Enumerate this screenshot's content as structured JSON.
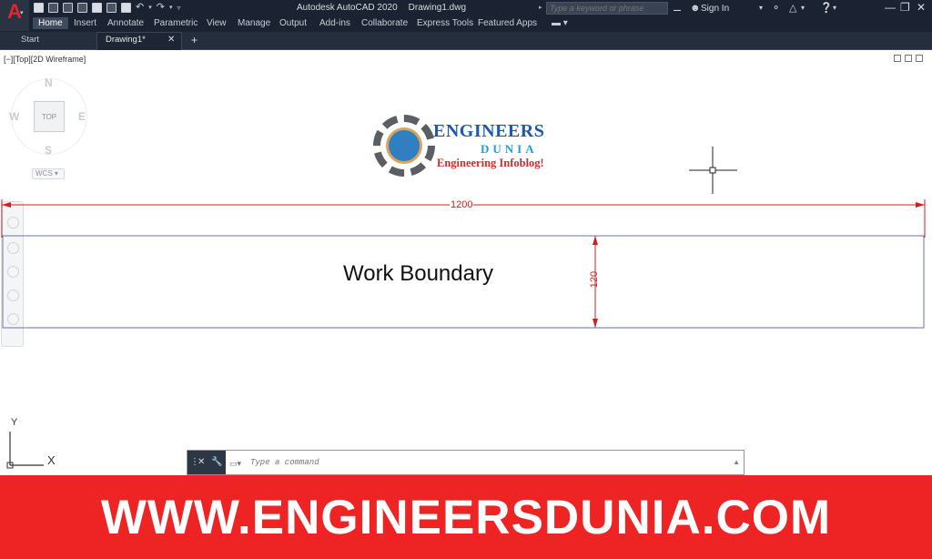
{
  "app": {
    "title": "Autodesk AutoCAD 2020",
    "file": "Drawing1.dwg",
    "logo_letter": "A"
  },
  "search": {
    "placeholder": "Type a keyword or phrase"
  },
  "account": {
    "signin_label": "Sign In"
  },
  "ribbon": {
    "tabs": [
      "Home",
      "Insert",
      "Annotate",
      "Parametric",
      "View",
      "Manage",
      "Output",
      "Add-ins",
      "Collaborate",
      "Express Tools",
      "Featured Apps"
    ],
    "active": "Home"
  },
  "doc_tabs": [
    "Start",
    "Drawing1*"
  ],
  "viewport": {
    "label": "[−][Top][2D Wireframe]"
  },
  "viewcube": {
    "n": "N",
    "s": "S",
    "e": "E",
    "w": "W",
    "face": "TOP",
    "wcs": "WCS"
  },
  "watermark": {
    "line1": "ENGINEERS",
    "line2": "DUNIA",
    "line3": "Engineering Infoblog!"
  },
  "drawing": {
    "text": "Work Boundary",
    "dim_width": "1200",
    "dim_height": "120",
    "ucs_y": "Y",
    "ucs_x": "X"
  },
  "command": {
    "placeholder": "Type a command"
  },
  "banner": {
    "text": "WWW.ENGINEERSDUNIA.COM"
  },
  "colors": {
    "titlebar": "#1b2332",
    "dimension": "#d11f1f",
    "boundary": "#6a6fb0",
    "banner": "#ee2424"
  }
}
